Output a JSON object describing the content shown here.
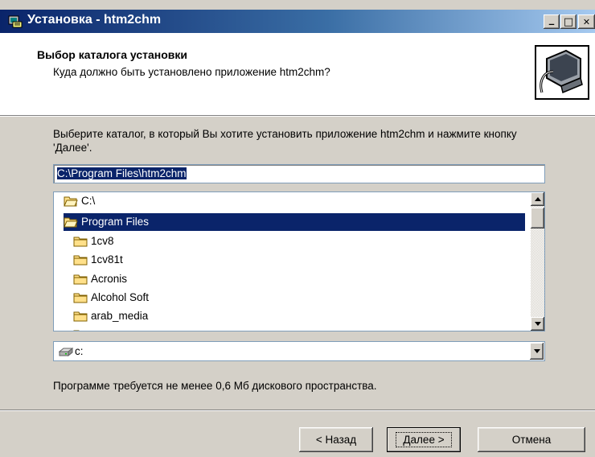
{
  "window": {
    "title": "Установка - htm2chm",
    "minimize_glyph": "_",
    "maximize_glyph": "□",
    "close_glyph": "✕",
    "titlebar_color": "#0a246a"
  },
  "header": {
    "title": "Выбор каталога установки",
    "subtitle": "Куда должно быть установлено приложение htm2chm?"
  },
  "body": {
    "description": "Выберите каталог, в который Вы хотите установить приложение htm2chm и нажмите кнопку 'Далее'.",
    "install_path": "C:\\Program Files\\htm2chm",
    "tree": [
      {
        "label": "C:\\",
        "icon": "open-folder-icon",
        "selected": false
      },
      {
        "label": "Program Files",
        "icon": "open-folder-icon",
        "selected": true
      },
      {
        "label": "1cv8",
        "icon": "folder-icon",
        "selected": false
      },
      {
        "label": "1cv81t",
        "icon": "folder-icon",
        "selected": false
      },
      {
        "label": "Acronis",
        "icon": "folder-icon",
        "selected": false
      },
      {
        "label": "Alcohol Soft",
        "icon": "folder-icon",
        "selected": false
      },
      {
        "label": "arab_media",
        "icon": "folder-icon",
        "selected": false
      }
    ],
    "drive": "c:",
    "space_required": "Программе требуется не менее 0,6 Мб дискового пространства."
  },
  "buttons": {
    "back": "< Назад",
    "next": "Далее >",
    "cancel": "Отмена"
  },
  "colors": {
    "selection": "#0a246a",
    "dialog_bg": "#d4d0c8"
  }
}
